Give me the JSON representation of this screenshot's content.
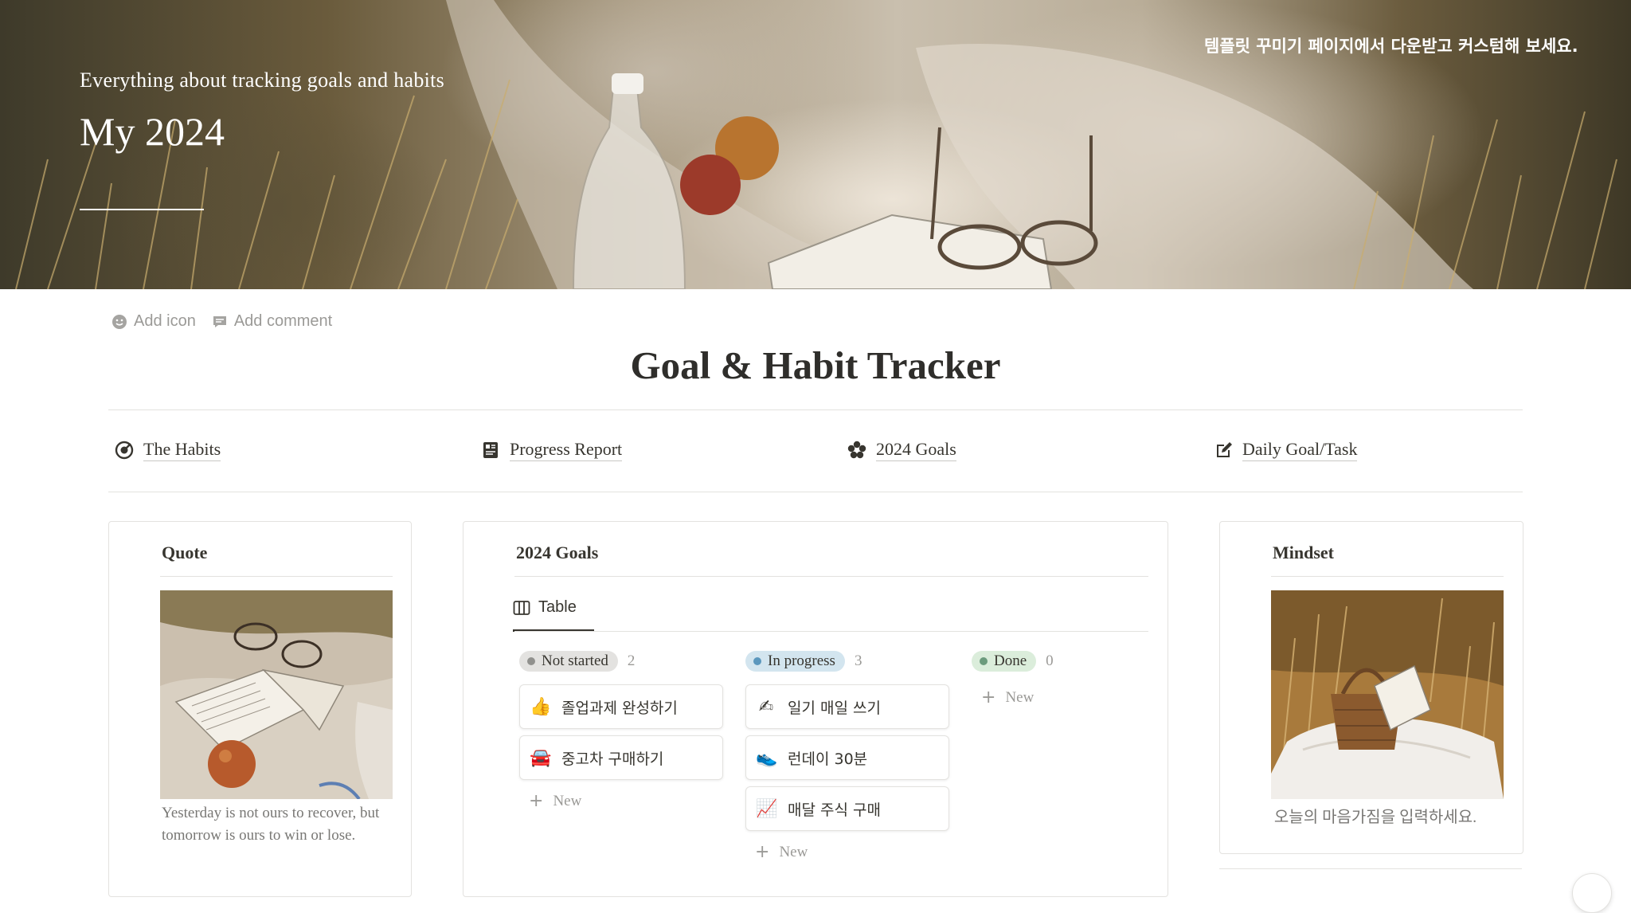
{
  "cover": {
    "subtitle": "Everything about tracking goals and habits",
    "title": "My 2024",
    "note": "템플릿 꾸미기 페이지에서 다운받고 커스텀해 보세요."
  },
  "page_controls": {
    "add_icon": "Add icon",
    "add_comment": "Add comment"
  },
  "page": {
    "title": "Goal & Habit Tracker"
  },
  "nav": {
    "items": [
      {
        "label": "The Habits",
        "icon": "target-icon"
      },
      {
        "label": "Progress Report",
        "icon": "report-icon"
      },
      {
        "label": "2024 Goals",
        "icon": "flower-icon"
      },
      {
        "label": "Daily Goal/Task",
        "icon": "edit-icon"
      }
    ]
  },
  "quote": {
    "title": "Quote",
    "text": "Yesterday is not ours to recover, but tomorrow is ours to win or lose."
  },
  "goals": {
    "title": "2024 Goals",
    "view_tab": "Table",
    "new_label": "New",
    "columns": [
      {
        "status": "Not started",
        "count": "2",
        "pill_color": "#e3e2e0",
        "dot_color": "#91918e",
        "items": [
          {
            "emoji": "👍",
            "label": "졸업과제 완성하기"
          },
          {
            "emoji": "🚘",
            "label": "중고차 구매하기"
          }
        ]
      },
      {
        "status": "In progress",
        "count": "3",
        "pill_color": "#d3e5ef",
        "dot_color": "#5b97bd",
        "items": [
          {
            "emoji": "✍",
            "label": "일기 매일 쓰기"
          },
          {
            "emoji": "👟",
            "label": "런데이 30분"
          },
          {
            "emoji": "📈",
            "label": "매달 주식 구매"
          }
        ]
      },
      {
        "status": "Done",
        "count": "0",
        "pill_color": "#dbeddb",
        "dot_color": "#6c9b7d",
        "items": []
      }
    ]
  },
  "mindset": {
    "title": "Mindset",
    "text": "오늘의 마음가짐을 입력하세요."
  },
  "colors": {
    "text": "#37352f",
    "muted": "#9b9a97",
    "border": "#e3e2df"
  }
}
